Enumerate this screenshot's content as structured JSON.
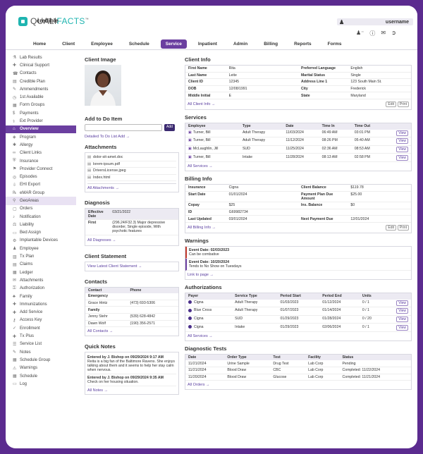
{
  "brand": {
    "name_a": "QUALI",
    "name_b": "FACTS",
    "tm": "™",
    "sub": "credible"
  },
  "user": {
    "name": "username",
    "icons": [
      "users-icon",
      "help-icon",
      "mail-icon",
      "logout-icon"
    ]
  },
  "nav": [
    "Home",
    "Client",
    "Employee",
    "Schedule",
    "Service",
    "Inpatient",
    "Admin",
    "Billing",
    "Reports",
    "Forms"
  ],
  "nav_active": "Service",
  "sidebar": [
    {
      "label": "Lab Results",
      "icon": "flask-icon"
    },
    {
      "label": "Clinical Support",
      "icon": "clinical-icon"
    },
    {
      "label": "Contacts",
      "icon": "contacts-icon"
    },
    {
      "label": "Credible Plan",
      "icon": "plan-icon"
    },
    {
      "label": "Ammendments",
      "icon": "amend-icon"
    },
    {
      "label": "1st Available",
      "icon": "calendar-icon"
    },
    {
      "label": "Form Groups",
      "icon": "form-icon"
    },
    {
      "label": "Payments",
      "icon": "payment-icon"
    },
    {
      "label": "Ext Provider",
      "icon": "provider-icon"
    },
    {
      "label": "Overview",
      "icon": "home-icon",
      "active": true
    },
    {
      "label": "Program",
      "icon": "program-icon"
    },
    {
      "label": "Allergy",
      "icon": "allergy-icon"
    },
    {
      "label": "Client Links",
      "icon": "link-icon"
    },
    {
      "label": "Insurance",
      "icon": "insurance-icon"
    },
    {
      "label": "Provider Connect",
      "icon": "connect-icon"
    },
    {
      "label": "Episodes",
      "icon": "episode-icon"
    },
    {
      "label": "EHI Export",
      "icon": "export-icon"
    },
    {
      "label": "eMAR Group",
      "icon": "emar-icon"
    },
    {
      "label": "GeoAreas",
      "icon": "geo-icon",
      "hl": true
    },
    {
      "label": "Orders",
      "icon": "orders-icon"
    },
    {
      "label": "Notification",
      "icon": "bell-icon"
    },
    {
      "label": "Liability",
      "icon": "liability-icon"
    },
    {
      "label": "Bed Assign",
      "icon": "bed-icon"
    },
    {
      "label": "Implantable Devices",
      "icon": "device-icon"
    },
    {
      "label": "Employee",
      "icon": "employee-icon"
    },
    {
      "label": "Tx Plan",
      "icon": "tx-icon"
    },
    {
      "label": "Claims",
      "icon": "claims-icon"
    },
    {
      "label": "Ledger",
      "icon": "ledger-icon"
    },
    {
      "label": "Attachments",
      "icon": "attach-icon"
    },
    {
      "label": "Authorization",
      "icon": "auth-icon"
    },
    {
      "label": "Family",
      "icon": "family-icon"
    },
    {
      "label": "Immunizations",
      "icon": "syringe-icon"
    },
    {
      "label": "Add Service",
      "icon": "add-service-icon"
    },
    {
      "label": "Access Key",
      "icon": "key-icon"
    },
    {
      "label": "Enrollment",
      "icon": "enroll-icon"
    },
    {
      "label": "Tx Plus",
      "icon": "txplus-icon"
    },
    {
      "label": "Service List",
      "icon": "list-icon"
    },
    {
      "label": "Notes",
      "icon": "notes-icon"
    },
    {
      "label": "Schedule Group",
      "icon": "schedule-icon"
    },
    {
      "label": "Warnings",
      "icon": "warning-icon"
    },
    {
      "label": "Schedule",
      "icon": "schedule2-icon"
    },
    {
      "label": "Log",
      "icon": "log-icon"
    }
  ],
  "client_image": {
    "title": "Client Image"
  },
  "todo": {
    "title": "Add to Do Item",
    "add": "Add",
    "link": "Detailed To Do List Add"
  },
  "attachments": {
    "title": "Attachments",
    "files": [
      "dolor-sit-amet.doc",
      "lorem-ipsum.pdf",
      "DriversLicense.jpeg",
      "Index.html"
    ],
    "link": "All Attachments"
  },
  "diagnosis": {
    "title": "Diagnosis",
    "eff_label": "Effective Date",
    "eff_date": "03/21/2022",
    "first_label": "First",
    "first_text": "(296.24/F32.3) Major depressive disorder, Single episode, With psychotic features",
    "link": "All Diagnoses"
  },
  "statement": {
    "title": "Client Statement",
    "link": "View Latest Client Statement"
  },
  "contacts": {
    "title": "Contacts",
    "h_contact": "Contact",
    "h_phone": "Phone",
    "group": "Emergency",
    "rows": [
      {
        "name": "Grace Hintz",
        "phone": "(473) 693-5306"
      },
      {
        "name": "Family",
        "phone": ""
      },
      {
        "name": "Jenny Stehr",
        "phone": "(539) 628-4842"
      },
      {
        "name": "Dawn Wolf",
        "phone": "(190) 356-2571"
      }
    ],
    "link": "All Contacts"
  },
  "notes": {
    "title": "Quick Notes",
    "items": [
      {
        "head": "Entered by J. Bishop on 09/29/2024 9:17 AM",
        "text": "Reita is a big fan of the Baltimore Ravens. She enjoys talking about them and it seems to help her stay calm when nervous."
      },
      {
        "head": "Entered by J. Bishop on 09/29/2024 9:35 AM",
        "text": "Check on her housing situation."
      }
    ],
    "link": "All Notes"
  },
  "client_info": {
    "title": "Client Info",
    "left": [
      [
        "First Name",
        "Rita"
      ],
      [
        "Last Name",
        "Leite"
      ],
      [
        "Client ID",
        "12345"
      ],
      [
        "DOB",
        "12/08/1991"
      ],
      [
        "Middle Initial",
        "E"
      ]
    ],
    "right": [
      [
        "Preferred Language",
        "English"
      ],
      [
        "Marital Status",
        "Single"
      ],
      [
        "Address Line 1",
        "123 South Main St."
      ],
      [
        "City",
        "Frederick"
      ],
      [
        "State",
        "Maryland"
      ]
    ],
    "link": "All Client Info",
    "edit": "Edit",
    "print": "Print"
  },
  "services": {
    "title": "Services",
    "headers": [
      "Employee",
      "Type",
      "Date",
      "Time In",
      "Time Out",
      ""
    ],
    "rows": [
      [
        "Turner, Bill",
        "Adult Therapy",
        "11/03/2024",
        "06:49 AM",
        "03:01 PM"
      ],
      [
        "Turner, Bill",
        "Adult Therapy",
        "11/12/2024",
        "08:26 PM",
        "05:40 AM"
      ],
      [
        "McLaughlin, Jill",
        "SUD",
        "11/25/2024",
        "02:36 AM",
        "08:53 AM"
      ],
      [
        "Turner, Bill",
        "Intake",
        "11/28/2024",
        "08:13 AM",
        "02:58 PM"
      ]
    ],
    "view": "View",
    "link": "All Services"
  },
  "billing": {
    "title": "Billing Info",
    "left": [
      [
        "Insurance",
        "Cigna"
      ],
      [
        "Start Date",
        "01/01/2024"
      ],
      [
        "Copay",
        "$25"
      ],
      [
        "ID",
        "G69982734"
      ],
      [
        "Last Updated",
        "03/01/2024"
      ]
    ],
    "right": [
      [
        "Client Balance",
        "$119.78"
      ],
      [
        "Payment Plan Due Amount",
        "$25.00"
      ],
      [
        "Ins. Balance",
        "$0"
      ],
      [
        "",
        ""
      ],
      [
        "Next Payment Due",
        "12/01/2024"
      ]
    ],
    "link": "All Billing Info",
    "edit": "Edit",
    "print": "Print"
  },
  "warnings": {
    "title": "Warnings",
    "items": [
      {
        "head": "Event Date: 02/03/2023",
        "text": "Can be combative"
      },
      {
        "head": "Event Date: 10/20/2024",
        "text": "Tends to No Show on Tuesdays"
      }
    ],
    "link": "Link to page"
  },
  "authorizations": {
    "title": "Authorizations",
    "headers": [
      "Payer",
      "Service Type",
      "Period Start",
      "Period End",
      "Units",
      ""
    ],
    "rows": [
      [
        "Cigna",
        "Adult Therapy",
        "01/03/2023",
        "01/12/2024",
        "0 / 1"
      ],
      [
        "Blue Cross",
        "Adult Therapy",
        "01/07/2023",
        "01/14/2024",
        "0 / 1"
      ],
      [
        "Cigna",
        "SUD",
        "01/29/2023",
        "01/28/2024",
        "0 / 20"
      ],
      [
        "Cigna",
        "Intake",
        "01/29/2023",
        "02/06/2024",
        "0 / 1"
      ]
    ],
    "view": "View",
    "link": "All Services"
  },
  "diagnostic": {
    "title": "Diagnostic Tests",
    "headers": [
      "Date",
      "Order Type",
      "Test",
      "Facility",
      "Status"
    ],
    "rows": [
      [
        "11/21/2024",
        "Urine Sample",
        "Drug Test",
        "Lab Corp",
        "Pending"
      ],
      [
        "11/21/2024",
        "Blood Draw",
        "CBC",
        "Lab Corp",
        "Completed: 11/22/2024"
      ],
      [
        "11/20/2024",
        "Blood Draw",
        "Glucose",
        "Lab Corp",
        "Completed: 11/21/2024"
      ]
    ],
    "link": "All Orders"
  }
}
